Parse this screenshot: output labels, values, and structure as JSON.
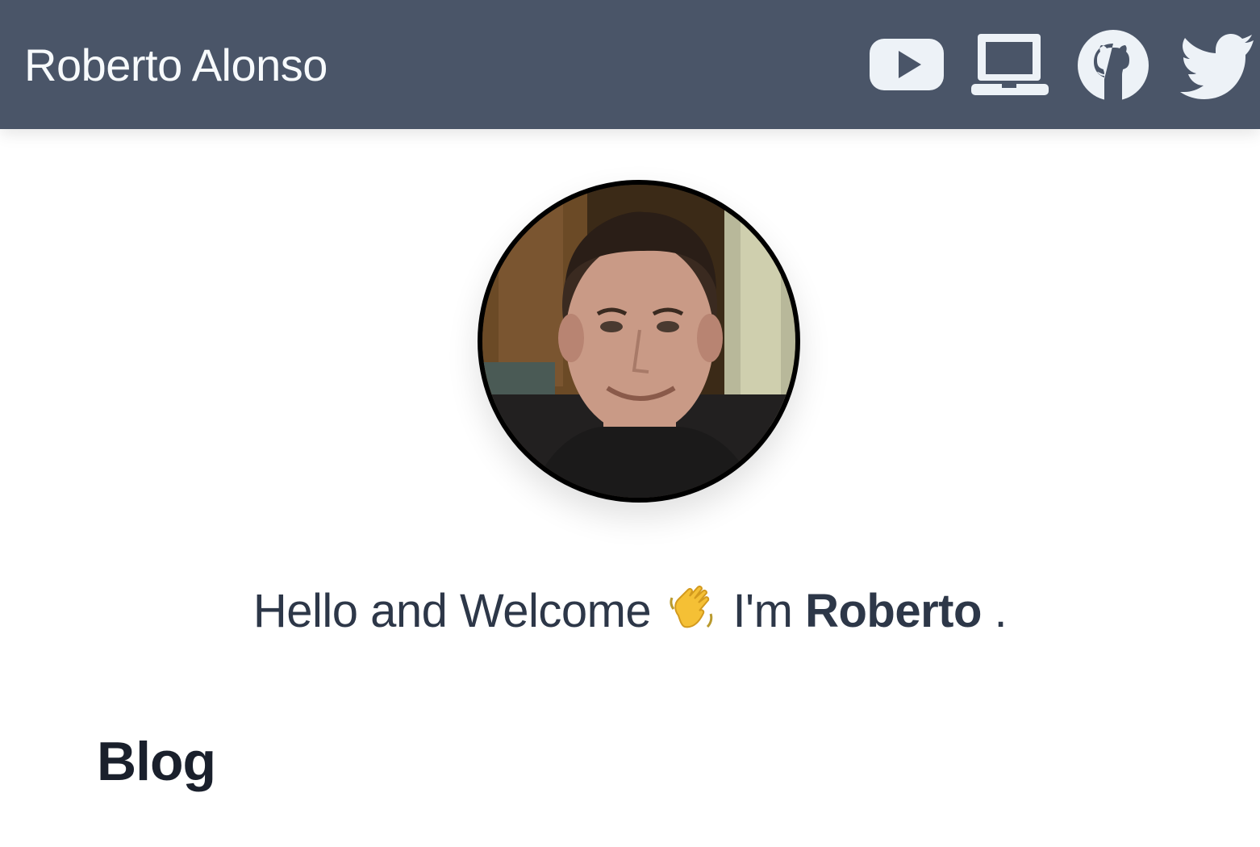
{
  "header": {
    "site_title": "Roberto Alonso",
    "background_color": "#4a5568",
    "icon_color": "#edf2f7",
    "social_links": [
      {
        "icon": "youtube-icon"
      },
      {
        "icon": "laptop-icon"
      },
      {
        "icon": "github-icon"
      },
      {
        "icon": "twitter-icon"
      }
    ]
  },
  "profile": {
    "avatar_icon": "profile-photo"
  },
  "greeting": {
    "text_before": "Hello and Welcome",
    "emoji": "👋",
    "text_middle": "I'm",
    "name": "Roberto",
    "text_after": "."
  },
  "blog": {
    "heading": "Blog"
  }
}
